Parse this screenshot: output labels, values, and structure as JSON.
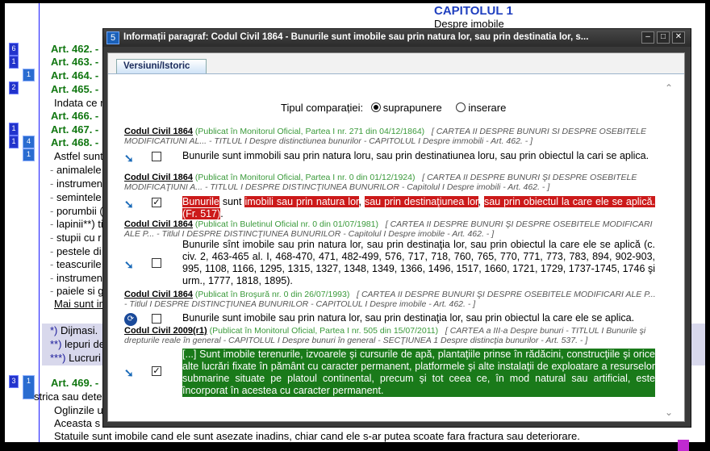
{
  "doc": {
    "chapter_title": "CAPITOLUL 1",
    "chapter_subtitle": "Despre imobile",
    "badges": [
      "6",
      "1",
      "1",
      "2",
      "1",
      "1",
      "4",
      "1",
      "3",
      "1"
    ],
    "articles": [
      "Art. 462. -",
      "Art. 463. -",
      "Art. 464. -",
      "Art. 465. -",
      "Art. 466. -",
      "Art. 467. -",
      "Art. 468. -"
    ],
    "lines": {
      "indata": "Indata ce r",
      "astfel": "Astfel sunt"
    },
    "bullets": [
      "animalele",
      "instrumen",
      "semintele",
      "porumbii (",
      "lapinii**) ti",
      "stupii cu r",
      "pestele di",
      "teascurile",
      "instrumen",
      "paiele si g"
    ],
    "mai_sunt": "Mai sunt im",
    "notes": [
      {
        "mark": "*)",
        "text": "Dijmasi."
      },
      {
        "mark": "**)",
        "text": "lepuri de"
      },
      {
        "mark": "***)",
        "text": "Lucruri"
      }
    ],
    "art469": "Art. 469. -",
    "strica": "strica sau deter",
    "oglinzile": "Oglinzile u",
    "aceasta": "Aceasta s",
    "statuile": "Statuile sunt imobile cand ele sunt asezate inadins, chiar cand ele s-ar putea scoate fara fractura sau deteriorare."
  },
  "dialog": {
    "icon_label": "5",
    "title": "Informații paragraf: Codul Civil 1864 -  Bunurile sunt imobile sau prin natura lor, sau prin destinatia lor, s...",
    "buttons": {
      "minimize": "–",
      "maximize": "□",
      "close": "✕"
    },
    "tab": "Versiuni/Istoric",
    "compare_label": "Tipul comparației:",
    "compare_options": [
      "suprapunere",
      "inserare"
    ],
    "compare_selected": "suprapunere",
    "versions": [
      {
        "code": "Codul Civil 1864",
        "pub": "(Publicat în Monitorul Oficial, Partea I nr. 271 din 04/12/1864)",
        "path": "[ CARTEA II DESPRE BUNURI SI DESPRE OSEBITELE MODIFICATIUNI AL... - TITLUL I Despre distinctiunea bunurilor - CAPITOLUL I Despre immobili - Art. 462. - ]",
        "checked": false,
        "text": "Bunurile sunt immobili sau prin natura loru, sau prin destinatiunea loru, sau prin obiectul la cari se aplica."
      },
      {
        "code": "Codul Civil 1864",
        "pub": "(Publicat în Monitorul Oficial, Partea I nr. 0 din 01/12/1924)",
        "path": "[ CARTEA II DESPRE BUNURI ŞI DESPRE OSEBITELE MODIFICAŢIUNI A... - TITLUL I DESPRE DISTINCŢIUNEA BUNURILOR - Capitolul I Despre imobili - Art. 462. - ]",
        "checked": true,
        "parts": [
          "Bunurile",
          " sunt ",
          "imobili sau prin natura lor",
          ", ",
          "sau prin destinaţiunea lor",
          ", ",
          "sau prin obiectul la care ele se aplică. (Fr. 517)",
          "."
        ]
      },
      {
        "code": "Codul Civil 1864",
        "pub": "(Publicat în Buletinul Oficial nr. 0 din 01/07/1981)",
        "path": "[ CARTEA II DESPRE BUNURI ŞI DESPRE OSEBITELE MODIFICARI ALE P... - Titlul I DESPRE DISTINCŢIUNEA BUNURILOR - Capitolul I Despre imobile - Art. 462. - ]",
        "checked": false,
        "text": "Bunurile sînt imobile sau prin natura lor, sau prin destinaţia lor, sau prin obiectul la care ele se aplică (c. civ. 2, 463-465 al. I, 468-470, 471, 482-499, 576, 717, 718, 760, 765, 770, 771, 773, 783, 894, 902-903, 995, 1108, 1166, 1295, 1315, 1327, 1348, 1349, 1366, 1496, 1517, 1660, 1721, 1729, 1737-1745, 1746 şi urm., 1777, 1818, 1895)."
      },
      {
        "code": "Codul Civil 1864",
        "pub": "(Publicat în Broşură nr. 0 din 26/07/1993)",
        "path": "[ CARTEA II DESPRE BUNURI ŞI DESPRE OSEBITELE MODIFICARI ALE P... - Titlul I DESPRE DISTINCŢIUNEA BUNURILOR - CAPITOLUL I Despre imobile - Art. 462. - ]",
        "checked": false,
        "text": "Bunurile sunt imobile sau prin natura lor, sau prin destinaţia lor, sau prin obiectul la care ele se aplica."
      },
      {
        "code": "Codul Civil 2009(r1)",
        "pub": "(Publicat în Monitorul Oficial, Partea I nr. 505 din 15/07/2011)",
        "path": "[ CARTEA a III-a Despre bunuri - TITLUL I Bunurile şi drepturile reale în general - CAPITOLUL I Despre bunuri în general - SECŢIUNEA 1 Despre distincţia bunurilor - Art. 537. - ]",
        "checked": true,
        "text": "[...] Sunt imobile terenurile, izvoarele şi cursurile de apă, plantaţiile prinse în rădăcini, construcţiile şi orice alte lucrări fixate în pământ cu caracter permanent, platformele şi alte instalaţii de exploatare a resurselor submarine situate pe platoul continental, precum şi tot ceea ce, în mod natural sau artificial, este încorporat în acestea cu caracter permanent."
      }
    ]
  }
}
